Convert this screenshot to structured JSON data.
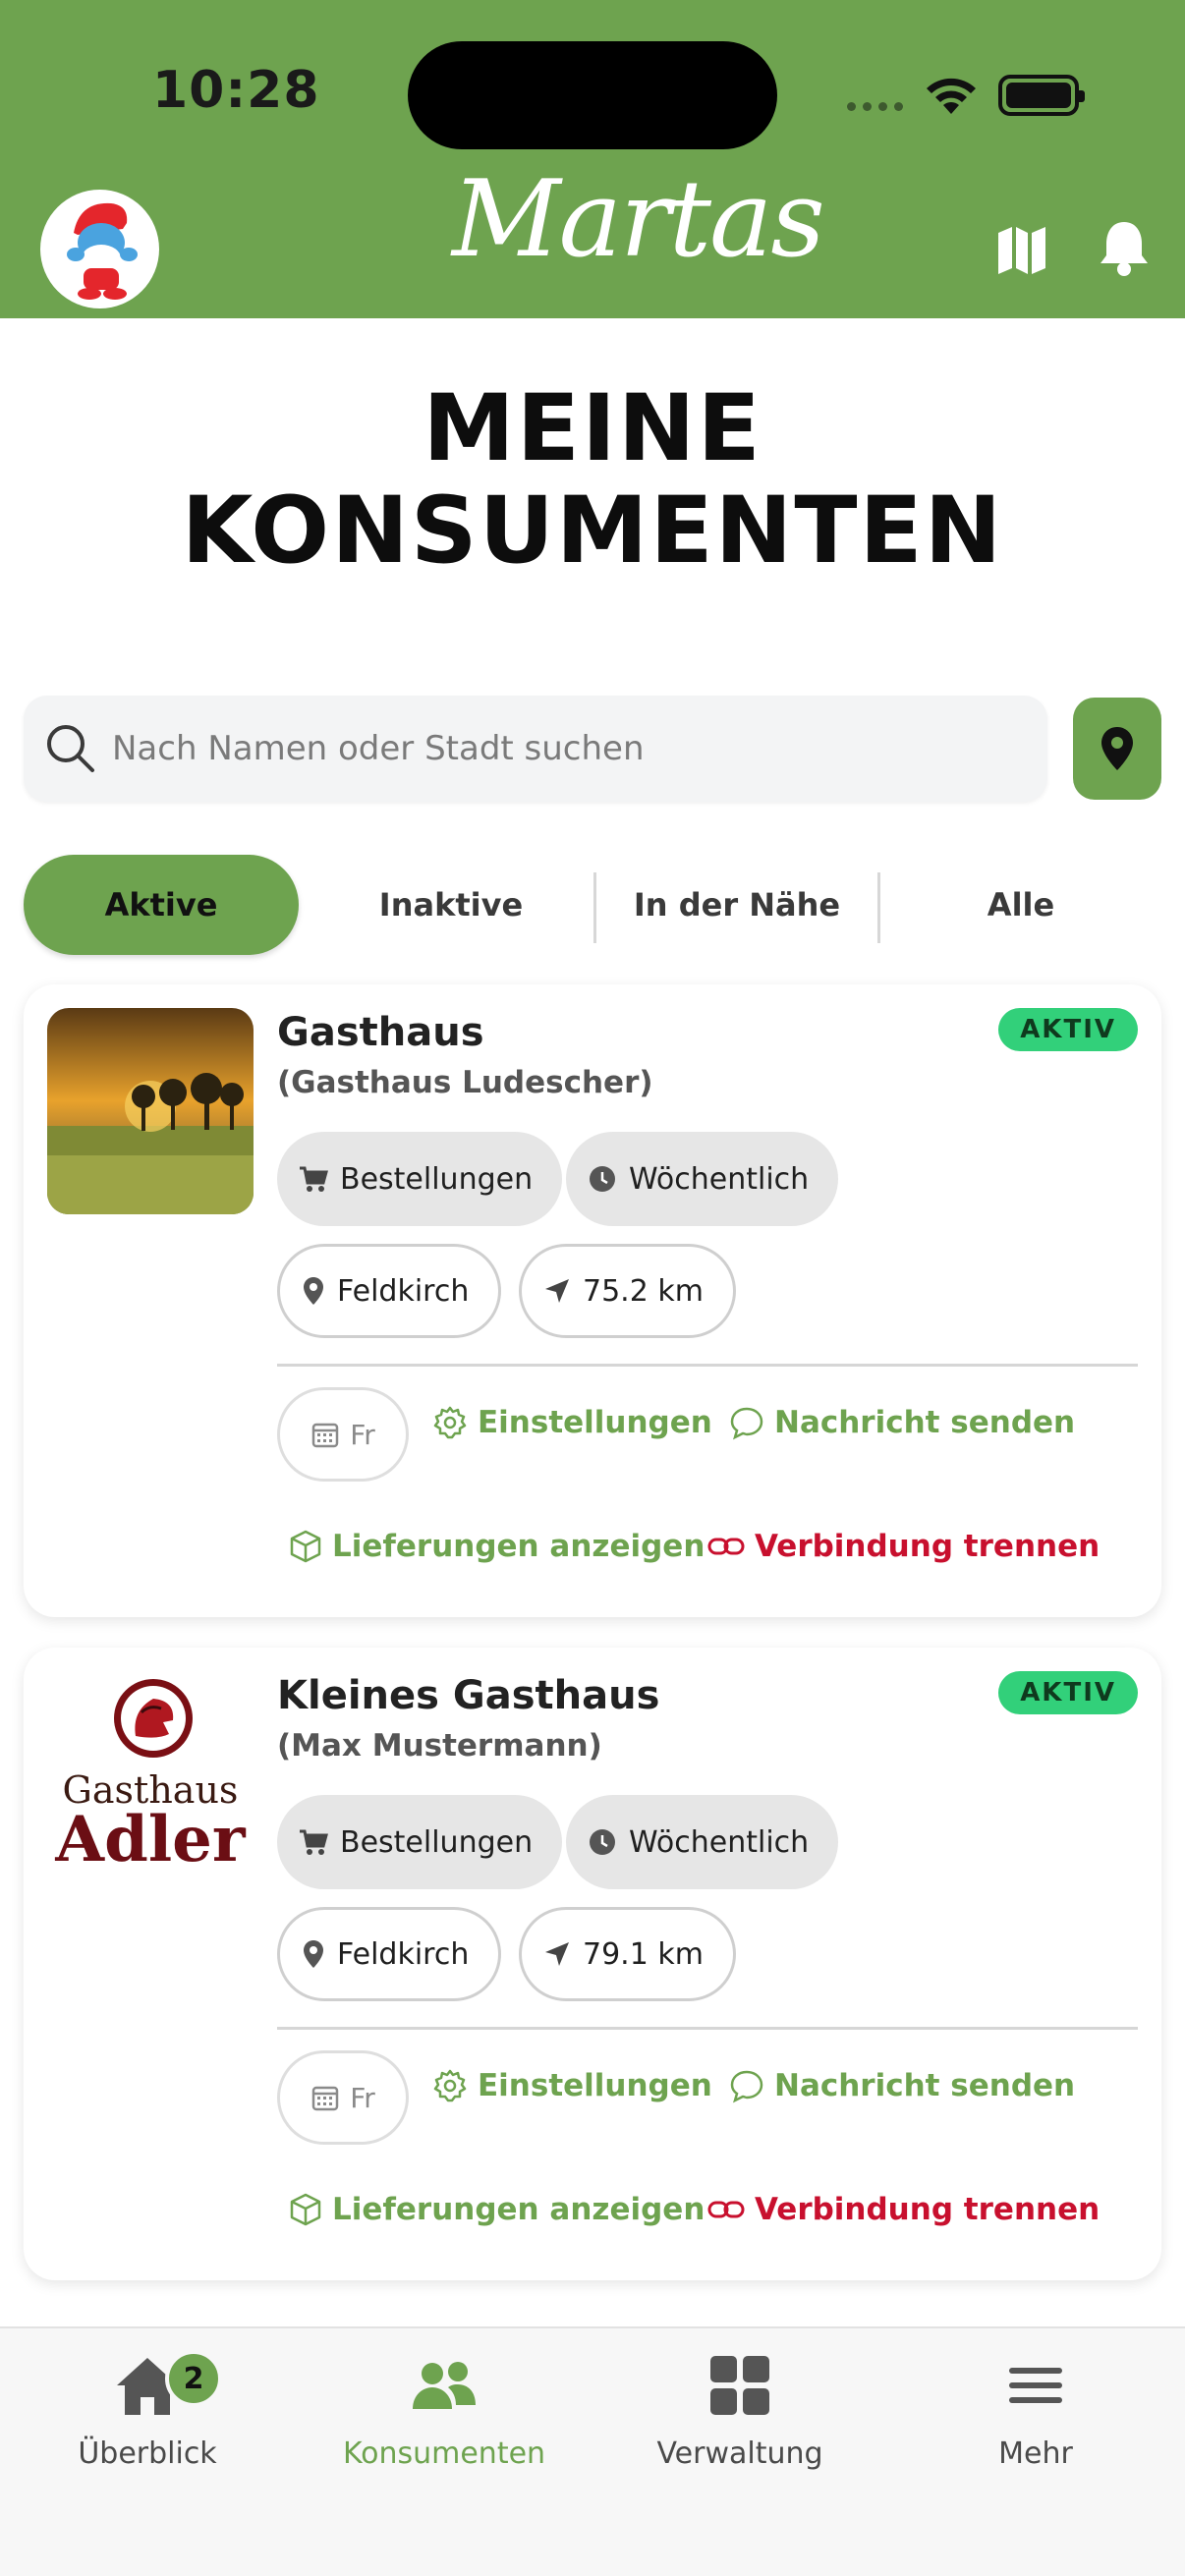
{
  "status_bar": {
    "time": "10:28"
  },
  "header": {
    "brand": "Martas"
  },
  "page": {
    "title_line1": "MEINE",
    "title_line2": "KONSUMENTEN"
  },
  "search": {
    "placeholder": "Nach Namen oder Stadt suchen"
  },
  "tabs": [
    {
      "label": "Aktive",
      "active": true
    },
    {
      "label": "Inaktive",
      "active": false
    },
    {
      "label": "In der Nähe",
      "active": false
    },
    {
      "label": "Alle",
      "active": false
    }
  ],
  "consumers": [
    {
      "name": "Gasthaus",
      "contact": "(Gasthaus Ludescher)",
      "status": "AKTIV",
      "type": "Bestellungen",
      "frequency": "Wöchentlich",
      "city": "Feldkirch",
      "distance": "75.2 km",
      "day": "Fr",
      "actions": {
        "settings": "Einstellungen",
        "message": "Nachricht senden",
        "deliveries": "Lieferungen anzeigen",
        "disconnect": "Verbindung trennen"
      }
    },
    {
      "name": "Kleines Gasthaus",
      "contact": "(Max Mustermann)",
      "status": "AKTIV",
      "type": "Bestellungen",
      "frequency": "Wöchentlich",
      "city": "Feldkirch",
      "distance": "79.1 km",
      "day": "Fr",
      "logo_text_line1": "Gasthaus",
      "logo_text_line2": "Adler",
      "actions": {
        "settings": "Einstellungen",
        "message": "Nachricht senden",
        "deliveries": "Lieferungen anzeigen",
        "disconnect": "Verbindung trennen"
      }
    }
  ],
  "bottom_nav": [
    {
      "label": "Überblick",
      "badge": "2",
      "icon": "home-icon"
    },
    {
      "label": "Konsumenten",
      "icon": "users-icon",
      "active": true
    },
    {
      "label": "Verwaltung",
      "icon": "grid-icon"
    },
    {
      "label": "Mehr",
      "icon": "menu-icon"
    }
  ],
  "colors": {
    "brand_green": "#6ea34f",
    "active_badge": "#32d07a",
    "danger": "#c8102e"
  }
}
